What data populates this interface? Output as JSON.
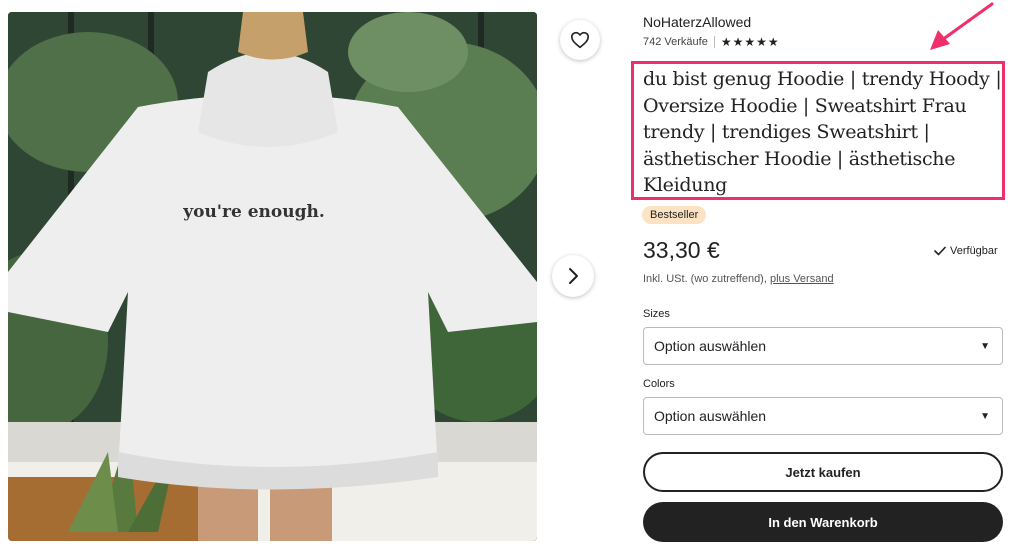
{
  "shop": {
    "name": "NoHaterzAllowed",
    "sales": "742 Verkäufe",
    "stars": "★★★★★"
  },
  "product": {
    "title": "du bist genug Hoodie | trendy Hoody | Oversize Hoodie | Sweatshirt Frau trendy | trendiges Sweatshirt | ästhetischer Hoodie | ästhetische Kleidung",
    "print_text": "you're enough.",
    "badge": "Bestseller",
    "price": "33,30 €",
    "availability": "Verfügbar",
    "tax_note": "Inkl. USt. (wo zutreffend),",
    "shipping_link": "plus Versand"
  },
  "options": {
    "sizes_label": "Sizes",
    "sizes_value": "Option auswählen",
    "colors_label": "Colors",
    "colors_value": "Option auswählen"
  },
  "actions": {
    "buy_now": "Jetzt kaufen",
    "add_to_cart": "In den Warenkorb"
  },
  "icons": {
    "favorite": "heart-icon",
    "next": "chevron-right-icon",
    "available": "checkmark-icon",
    "dropdown": "caret-down-icon",
    "annotation": "arrow-icon"
  },
  "colors": {
    "highlight_border": "#ef2e6b",
    "badge_bg": "#fde3c3",
    "primary_button": "#222222"
  }
}
